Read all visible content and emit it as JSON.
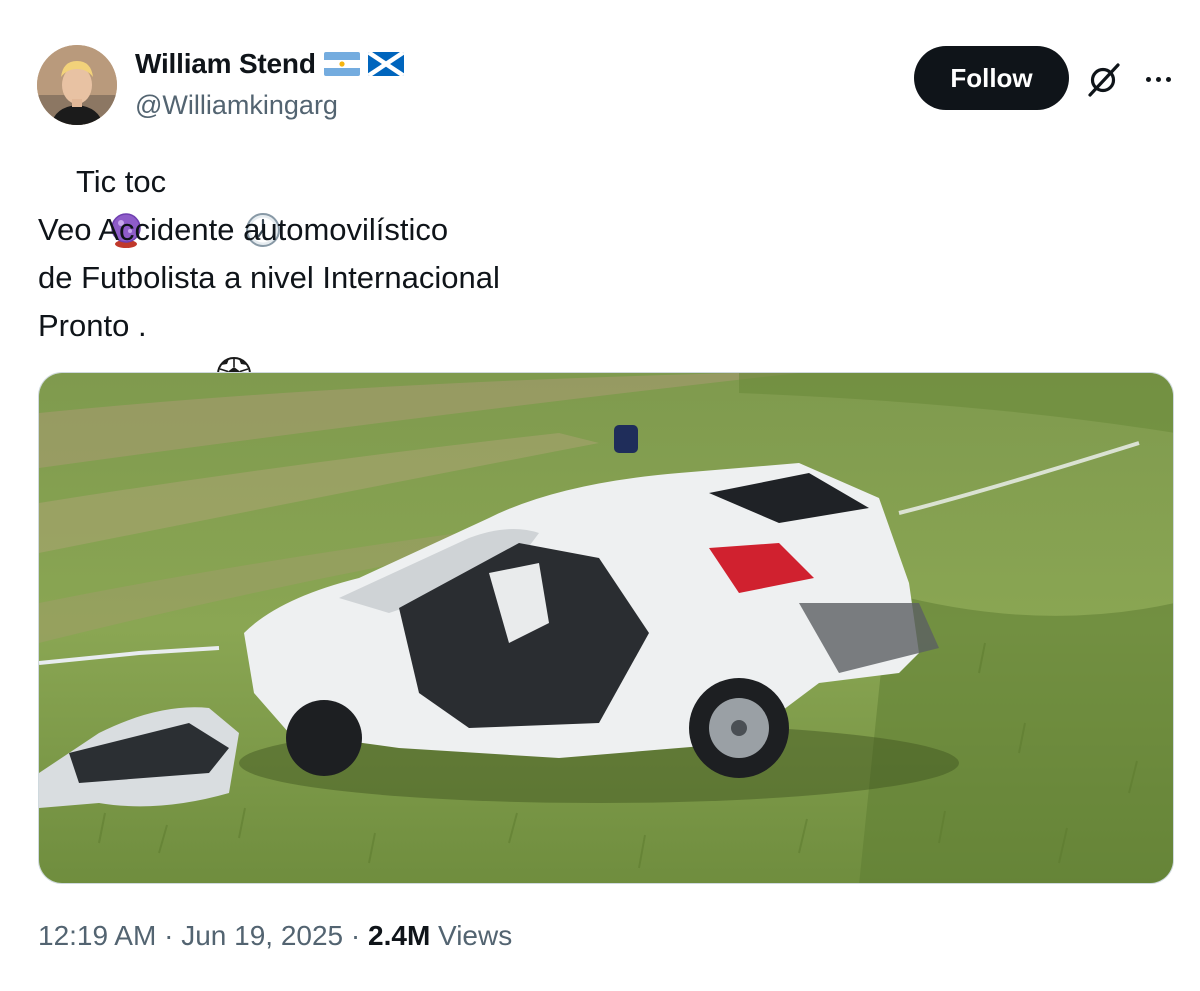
{
  "author": {
    "display_name": "William Stend",
    "handle": "@Williamkingarg",
    "flags": [
      "argentina-flag-icon",
      "scotland-flag-icon"
    ]
  },
  "actions": {
    "follow_label": "Follow",
    "grok_icon": "grok-icon",
    "more_icon": "more-options-icon"
  },
  "post": {
    "line1_text": "Tic toc ",
    "line1_prefix_icon": "crystal-ball-icon",
    "line1_suffix_icon": "clock-icon",
    "line2": "Veo Accidente automovilístico",
    "line3": "de Futbolista a nivel Internacional",
    "line4_text": "Pronto .",
    "line4_suffix_icon": "soccer-ball-icon"
  },
  "media": {
    "kind": "photo",
    "subject": "wrecked white car in grass field"
  },
  "footer": {
    "time": "12:19 AM",
    "sep1": " · ",
    "date": "Jun 19, 2025",
    "sep2": " · ",
    "views_count": "2.4M",
    "views_label": " Views"
  },
  "colors": {
    "text_primary": "#0f1419",
    "text_secondary": "#536471",
    "follow_bg": "#0f1419",
    "follow_text": "#ffffff",
    "border": "#cfd9de"
  }
}
